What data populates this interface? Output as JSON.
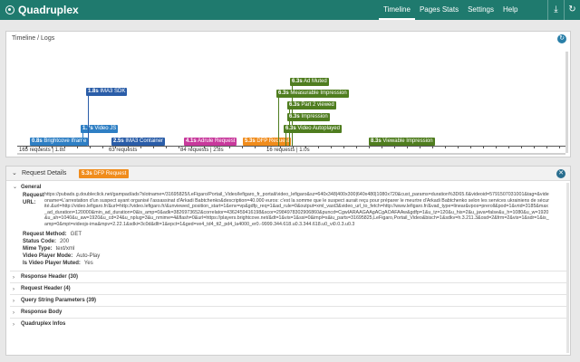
{
  "app": {
    "title": "Quadruplex"
  },
  "nav": [
    {
      "label": "Timeline",
      "active": true
    },
    {
      "label": "Pages Stats",
      "active": false
    },
    {
      "label": "Settings",
      "active": false
    },
    {
      "label": "Help",
      "active": false
    }
  ],
  "topicons": [
    "download-icon",
    "refresh-icon"
  ],
  "timeline": {
    "title": "Timeline / Logs",
    "events": [
      {
        "time": "0.8s",
        "label": "Brightcove Iframe",
        "color": "#2e7fc4"
      },
      {
        "time": "1.7s",
        "label": "Video JS",
        "color": "#2e7fc4"
      },
      {
        "time": "1.8s",
        "label": "IMA3 SDK",
        "color": "#2a5da8"
      },
      {
        "time": "2.5s",
        "label": "IMA3 Container",
        "color": "#2a5da8"
      },
      {
        "time": "4.1s",
        "label": "Adrule Request",
        "color": "#c8399c"
      },
      {
        "time": "5.3s",
        "label": "DFP Request",
        "color": "#f08c1c"
      },
      {
        "time": "6.3s",
        "label": "Ad Muted",
        "color": "#4f7d1f"
      },
      {
        "time": "6.3s",
        "label": "Measurable Impression",
        "color": "#4f7d1f"
      },
      {
        "time": "6.3s",
        "label": "Part 2 viewed",
        "color": "#4f7d1f"
      },
      {
        "time": "6.3s",
        "label": "Impression",
        "color": "#4f7d1f"
      },
      {
        "time": "6.3s",
        "label": "Video Autoplayed",
        "color": "#4f7d1f"
      },
      {
        "time": "8.3s",
        "label": "Viewable Impression",
        "color": "#4f7d1f"
      }
    ],
    "segments": [
      "165 requests | 1.8s",
      "63 requests",
      "84 requests | 2.8s",
      "16 requests | 1.0s"
    ]
  },
  "details": {
    "title": "Request Details",
    "badge_time": "5.3s",
    "badge_label": "DFP Request",
    "general_label": "General",
    "request_url_key": "Request URL:",
    "request_url": "https://pubads.g.doubleclick.net/gampad/ads?slotname=/31695825/LeFigaro/Portail_Video/lefigaro_fr_portail/video_lefigaro&sz=640x348|400x300|640x480|1080x720&cust_params=duration%3D65.6&videoid=5791507031001&tag=&videoname=L'arrestation d'un suspect ayant organisé l'assassinat d'Arkadi Babtchenko&description=40.000 euros: c'est la somme que le suspect aurait reçu pour préparer le meurtre d'Arkadi Babtchenko selon les services ukrainiens de sécurité.&url=http://video.lefigaro.fr/&url=http://video.lefigaro.fr/&unviewed_position_start=1&env=vp&gdfp_req=1&ad_rule=0&output=xml_vast3&video_url_to_fetch=http://www.lefigaro.fr/&vad_type=linear&vpos=preroll&pod=1&vrid=3185&max_ad_duration=120000&min_ad_duration=0&is_amp=0&adk=3826973652&correlator=4362459416198&scor=2984978302906860&puncd=CgwIARAAGAAgACgAOAFAAw&gdfp=1&u_tz=120&u_his=2&u_java=false&u_h=1080&u_w=1920&u_ah=1040&u_aw=1920&u_cd=24&u_nplug=3&u_nmime=4&flash=0&url=https://players.brightcove.net/&dt=1&vis=1&ssi=0&impl=s&iu_parts=31695825,LeFigaro,Portail_Video&bisch=1&sdkv=h.3.211.3&osd=2&frm=2&vis=1&sdr=1&is_amp=0&mpt=videojs-ima&mpv=2.22.1&sdki=3c0d&dlt=1&epct=1&ged=ve4_td4_tt2_pd4_la4000_er0.-9999.344.618.u0.3.344.618.u0_vi0.0.3.u0.3",
    "fields": [
      {
        "key": "Request Method:",
        "value": "GET"
      },
      {
        "key": "Status Code:",
        "value": "200"
      },
      {
        "key": "Mime Type:",
        "value": "text/xml"
      },
      {
        "key": "Video Player Mode:",
        "value": "Auto-Play"
      },
      {
        "key": "Is Video Player Muted:",
        "value": "Yes"
      }
    ],
    "sections": [
      "Response Header (30)",
      "Request Header (4)",
      "Query String Parameters (39)",
      "Response Body",
      "Quadruplex Infos"
    ]
  }
}
